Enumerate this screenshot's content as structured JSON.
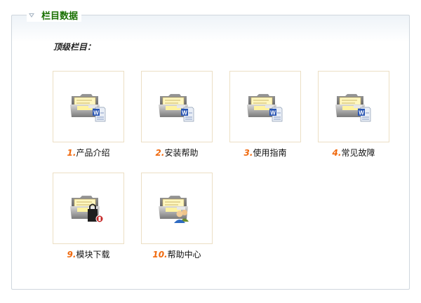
{
  "section": {
    "title": "栏目数据",
    "subtitle": "顶级栏目：",
    "items": [
      {
        "num": "1.",
        "label": "产品介绍",
        "icon": "folder-word-icon"
      },
      {
        "num": "2.",
        "label": "安装帮助",
        "icon": "folder-word-icon"
      },
      {
        "num": "3.",
        "label": "使用指南",
        "icon": "folder-word-icon"
      },
      {
        "num": "4.",
        "label": "常见故障",
        "icon": "folder-word-icon"
      },
      {
        "num": "9.",
        "label": "模块下载",
        "icon": "folder-lock-icon"
      },
      {
        "num": "10.",
        "label": "帮助中心",
        "icon": "folder-users-icon"
      }
    ]
  },
  "colors": {
    "title": "#187000",
    "number": "#f06a0f",
    "box_border": "#ecdfc4",
    "panel_border": "#cfd6dd"
  }
}
